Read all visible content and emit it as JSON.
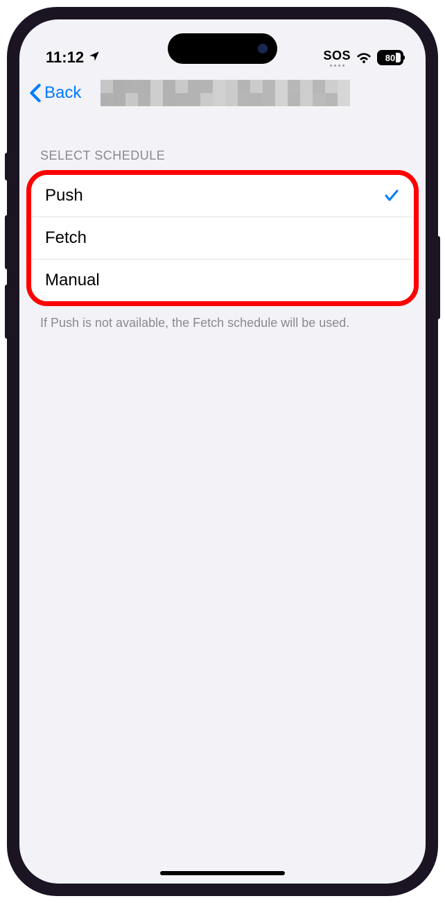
{
  "status": {
    "time": "11:12",
    "sos": "SOS",
    "battery_percent": "80"
  },
  "nav": {
    "back_label": "Back"
  },
  "section": {
    "header": "SELECT SCHEDULE",
    "footer": "If Push is not available, the Fetch schedule will be used."
  },
  "options": [
    {
      "label": "Push",
      "selected": true
    },
    {
      "label": "Fetch",
      "selected": false
    },
    {
      "label": "Manual",
      "selected": false
    }
  ]
}
